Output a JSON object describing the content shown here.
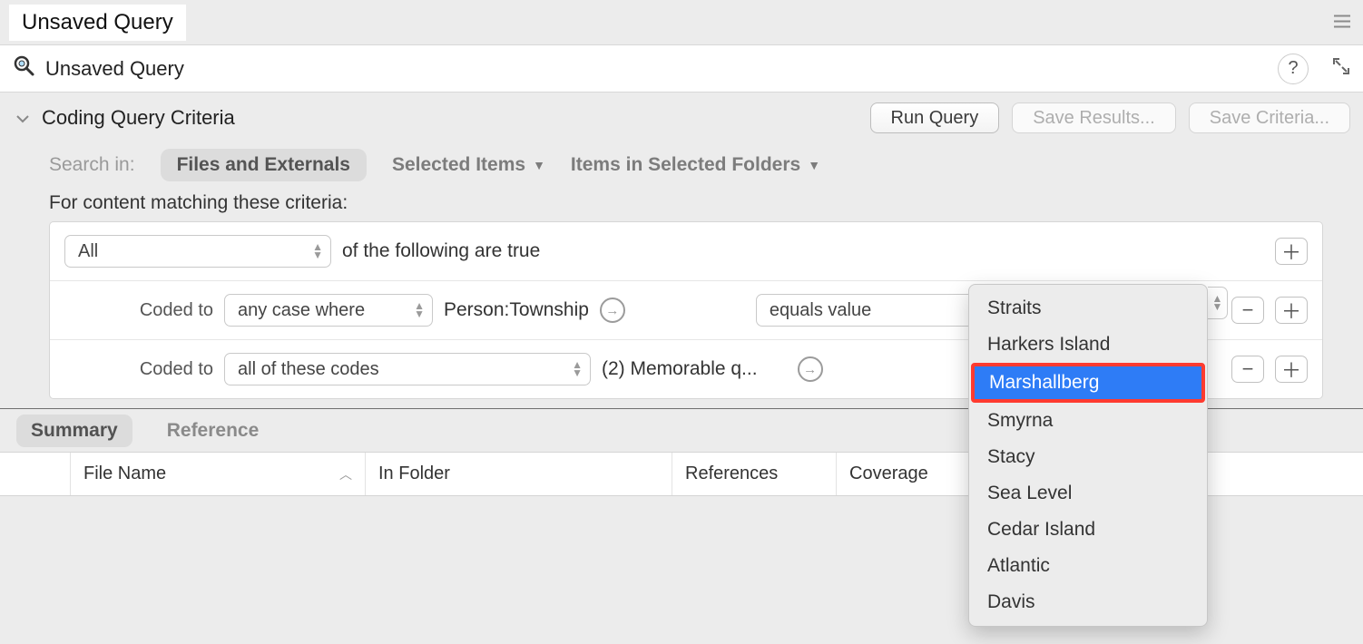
{
  "title": "Unsaved Query",
  "breadcrumb": "Unsaved Query",
  "criteria_header": "Coding Query Criteria",
  "buttons": {
    "run": "Run Query",
    "save_results": "Save Results...",
    "save_criteria": "Save Criteria..."
  },
  "search": {
    "label": "Search in:",
    "scope1": "Files and Externals",
    "scope2": "Selected Items",
    "scope3": "Items in Selected Folders"
  },
  "matching_label": "For content matching these criteria:",
  "row1": {
    "select": "All",
    "suffix": "of the following are true"
  },
  "row2": {
    "label": "Coded to",
    "select": "any case where",
    "attr": "Person:Township",
    "op": "equals value"
  },
  "row3": {
    "label": "Coded to",
    "select": "all of these codes",
    "value": "(2) Memorable q..."
  },
  "tabs": {
    "summary": "Summary",
    "reference": "Reference"
  },
  "columns": {
    "filename": "File Name",
    "folder": "In Folder",
    "refs": "References",
    "cov": "Coverage"
  },
  "dropdown": {
    "items": [
      "Straits",
      "Harkers Island",
      "Marshallberg",
      "Smyrna",
      "Stacy",
      "Sea Level",
      "Cedar Island",
      "Atlantic",
      "Davis"
    ],
    "highlighted": "Marshallberg"
  }
}
